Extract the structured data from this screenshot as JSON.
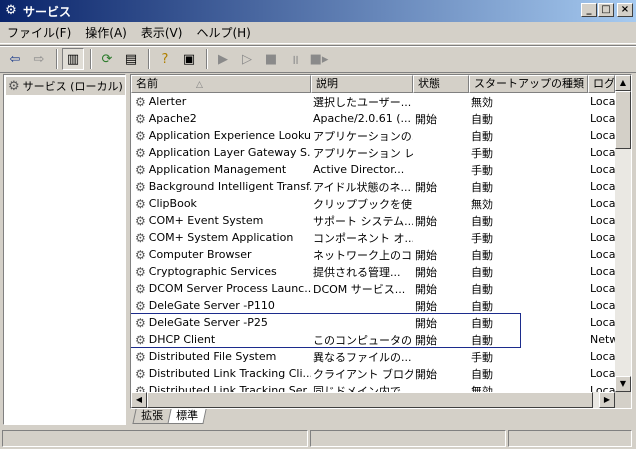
{
  "window": {
    "title": "サービス"
  },
  "menu": [
    "ファイル(F)",
    "操作(A)",
    "表示(V)",
    "ヘルプ(H)"
  ],
  "toolbar": {
    "icons": [
      "back-arrow-icon",
      "forward-arrow-icon",
      "show-tree-icon",
      "refresh-icon",
      "export-list-icon",
      "help-icon",
      "console-icon",
      "play-icon",
      "play-alt-icon",
      "stop-icon",
      "pause-icon",
      "restart-icon"
    ]
  },
  "tree": {
    "root_label": "サービス (ローカル)"
  },
  "columns": {
    "name": "名前",
    "description": "説明",
    "status": "状態",
    "startup": "スタートアップの種類",
    "logon": "ログオ"
  },
  "services": [
    {
      "name": "Alerter",
      "description": "選択したユーザー...",
      "status": "",
      "startup": "無効",
      "logon": "Loca"
    },
    {
      "name": "Apache2",
      "description": "Apache/2.0.61 (...",
      "status": "開始",
      "startup": "自動",
      "logon": "Loca"
    },
    {
      "name": "Application Experience Looku...",
      "description": "アプリケーションの...",
      "status": "",
      "startup": "自動",
      "logon": "Loca"
    },
    {
      "name": "Application Layer Gateway S...",
      "description": "アプリケーション レ...",
      "status": "",
      "startup": "手動",
      "logon": "Loca"
    },
    {
      "name": "Application Management",
      "description": "Active Director...",
      "status": "",
      "startup": "手動",
      "logon": "Loca"
    },
    {
      "name": "Background Intelligent Transf...",
      "description": "アイドル状態のネ...",
      "status": "開始",
      "startup": "自動",
      "logon": "Loca"
    },
    {
      "name": "ClipBook",
      "description": "クリップブックを使...",
      "status": "",
      "startup": "無効",
      "logon": "Loca"
    },
    {
      "name": "COM+ Event System",
      "description": "サポート システム...",
      "status": "開始",
      "startup": "自動",
      "logon": "Loca"
    },
    {
      "name": "COM+ System Application",
      "description": "コンポーネント オ...",
      "status": "",
      "startup": "手動",
      "logon": "Loca"
    },
    {
      "name": "Computer Browser",
      "description": "ネットワーク上のコ...",
      "status": "開始",
      "startup": "自動",
      "logon": "Loca"
    },
    {
      "name": "Cryptographic Services",
      "description": "提供される管理...",
      "status": "開始",
      "startup": "自動",
      "logon": "Loca"
    },
    {
      "name": "DCOM Server Process Launc...",
      "description": "DCOM サービス...",
      "status": "開始",
      "startup": "自動",
      "logon": "Loca"
    },
    {
      "name": "DeleGate Server -P110",
      "description": "",
      "status": "開始",
      "startup": "自動",
      "logon": "Loca"
    },
    {
      "name": "DeleGate Server -P25",
      "description": "",
      "status": "開始",
      "startup": "自動",
      "logon": "Loca"
    },
    {
      "name": "DHCP Client",
      "description": "このコンピュータの...",
      "status": "開始",
      "startup": "自動",
      "logon": "Netw"
    },
    {
      "name": "Distributed File System",
      "description": "異なるファイルの...",
      "status": "",
      "startup": "手動",
      "logon": "Loca"
    },
    {
      "name": "Distributed Link Tracking Cli...",
      "description": "クライアント ブログ...",
      "status": "開始",
      "startup": "自動",
      "logon": "Loca"
    },
    {
      "name": "Distributed Link Tracking Ser...",
      "description": "同じドメイン内で...",
      "status": "",
      "startup": "無効",
      "logon": "Loca"
    }
  ],
  "tabs": [
    {
      "label": "拡張",
      "active": false
    },
    {
      "label": "標準",
      "active": true
    }
  ]
}
